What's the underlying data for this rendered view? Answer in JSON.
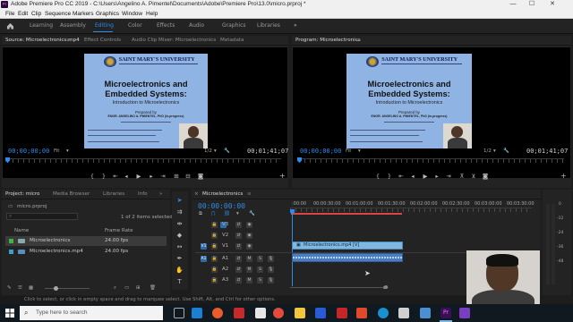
{
  "window": {
    "app_icon": "Pr",
    "title": "Adobe Premiere Pro CC 2019 - C:\\Users\\Angelino A. Pimentel\\Documents\\Adobe\\Premiere Pro\\13.0\\micro.prproj *",
    "minimize": "—",
    "maximize": "☐",
    "close": "✕"
  },
  "menu": [
    "File",
    "Edit",
    "Clip",
    "Sequence",
    "Markers",
    "Graphics",
    "Window",
    "Help"
  ],
  "workspaces": {
    "items": [
      "Learning",
      "Assembly",
      "Editing",
      "Color",
      "Effects",
      "Audio",
      "Graphics",
      "Libraries"
    ],
    "active": "Editing",
    "more": "»"
  },
  "source_monitor": {
    "tabs": [
      "Source: Microelectronics.mp4",
      "Effect Controls",
      "Audio Clip Mixer: Microelectronics",
      "Metadata"
    ],
    "timecode": "00;00;00;00",
    "fit": "Fit",
    "resolution": "1/2",
    "duration": "00;01;41;07"
  },
  "program_monitor": {
    "tabs": [
      "Program: Microelectronics"
    ],
    "timecode": "00;00;00;00",
    "fit": "Fit",
    "resolution": "1/2",
    "duration": "00;01;41;07"
  },
  "slide": {
    "university": "SAINT MARY'S UNIVERSITY",
    "title_line1": "Microelectronics and",
    "title_line2": "Embedded Systems:",
    "subtitle": "Introduction to Microelectronics",
    "prepared": "Prepared by",
    "author": "ENGR. ANGELINO A. PIMENTEL, PhD (in-progress)"
  },
  "project_panel": {
    "tabs": [
      "Project: micro",
      "Media Browser",
      "Libraries",
      "Info"
    ],
    "more": "»",
    "file": "micro.prproj",
    "selection_info": "1 of 2 items selected",
    "columns": [
      "Name",
      "Frame Rate"
    ],
    "rows": [
      {
        "name": "Microelectronics",
        "fps": "24.00 fps",
        "color": "#3db63d",
        "selected": true
      },
      {
        "name": "Microelectronics.mp4",
        "fps": "24.00 fps",
        "color": "#3aa0c8",
        "selected": false
      }
    ]
  },
  "timeline": {
    "tab": "Microelectronics",
    "timecode": "00:00:00:00",
    "ruler_labels": [
      ":00:00",
      "00:00:30:00",
      "00:01:00:00",
      "00:01:30:00",
      "00:02:00:00",
      "00:02:30:00",
      "00:03:00:00",
      "00:03:30:00"
    ],
    "video_tracks": [
      "V3",
      "V2",
      "V1"
    ],
    "audio_tracks": [
      "A1",
      "A2",
      "A3"
    ],
    "video_clip": "Microelectronics.mp4 [V]",
    "audio_levels": [
      "0",
      "-12",
      "-24",
      "-36",
      "-48"
    ]
  },
  "status_bar": "Click to select, or click in empty space and drag to marquee select. Use Shift, Alt, and Ctrl for other options.",
  "taskbar": {
    "search_placeholder": "Type here to search"
  }
}
